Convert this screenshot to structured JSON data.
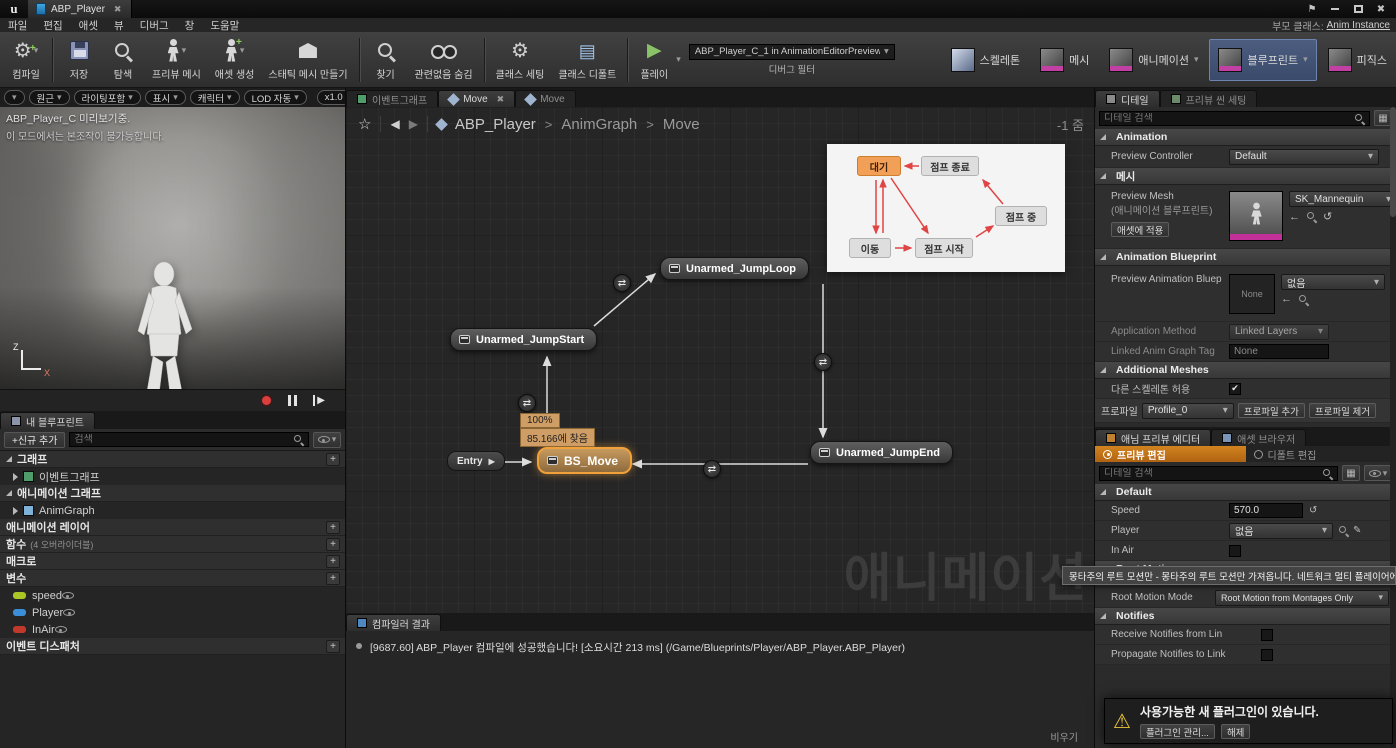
{
  "titlebar": {
    "logo": "u",
    "tab_title": "ABP_Player"
  },
  "menubar": {
    "items": [
      "파일",
      "편집",
      "애셋",
      "뷰",
      "디버그",
      "창",
      "도움말"
    ],
    "parent_class_label": "부모 클래스:",
    "parent_class_value": "Anim Instance"
  },
  "toolbar": {
    "compile": "컴파일",
    "save": "저장",
    "browse": "탐색",
    "preview_mesh": "프리뷰 메시",
    "create_asset": "애셋 생성",
    "make_static_mesh": "스태틱 메시 만들기",
    "find": "찾기",
    "hide_unrelated": "관련없음 숨김",
    "class_settings": "클래스 세팅",
    "class_defaults": "클래스 디폴트",
    "play": "플레이",
    "debug_object": "ABP_Player_C_1 in AnimationEditorPreviewActor",
    "debug_filter": "디버그 필터",
    "modes": [
      "스켈레톤",
      "메시",
      "애니메이션",
      "블루프린트",
      "피직스"
    ]
  },
  "viewport": {
    "buttons": [
      "원근",
      "라이팅포함",
      "표시",
      "캐릭터",
      "LOD 자동"
    ],
    "scale_button": "x1.0",
    "overlay_title": "ABP_Player_C 미리보기중.",
    "overlay_subtitle": "이 모드에서는 본조작이 불가능합니다.",
    "axis_z": "Z",
    "axis_x": "X"
  },
  "my_blueprint": {
    "tab": "내 블루프린트",
    "add_new": "+신규 추가",
    "search_placeholder": "검색",
    "graph_header": "그래프",
    "event_graph": "이벤트그래프",
    "anim_graph_header": "애니메이션 그래프",
    "anim_graph": "AnimGraph",
    "anim_layers_header": "애니메이션 레이어",
    "functions_header": "함수",
    "functions_note": "(4 오버라이더블)",
    "macros_header": "매크로",
    "variables_header": "변수",
    "variables": [
      "speed",
      "Player",
      "InAir"
    ],
    "dispatchers_header": "이벤트 디스패처"
  },
  "graph": {
    "tabs": [
      "이벤트그래프",
      "Move",
      "Move"
    ],
    "breadcrumb": [
      "ABP_Player",
      "AnimGraph",
      "Move"
    ],
    "crumb_sep": ">",
    "zoom_label": "-1 줌",
    "entry_node": "Entry",
    "nodes": {
      "bs_move": "BS_Move",
      "jump_start": "Unarmed_JumpStart",
      "jump_loop": "Unarmed_JumpLoop",
      "jump_end": "Unarmed_JumpEnd"
    },
    "tooltip_percent": "100%",
    "tooltip_position": "85.166에 찾음",
    "watermark": "애니메이션",
    "inset_states": {
      "idle": "대기",
      "jump_end": "점프 종료",
      "jump_mid": "점프 중",
      "move": "이동",
      "jump_start": "점프 시작"
    }
  },
  "compiler": {
    "tab": "컴파일러 결과",
    "log": "[9687.60] ABP_Player 컴파일에 성공했습니다! [소요시간 213 ms] (/Game/Blueprints/Player/ABP_Player.ABP_Player)",
    "clear_button": "비우기"
  },
  "details": {
    "tab_details": "디테일",
    "tab_preview_scene": "프리뷰 씬 세팅",
    "search_placeholder": "디테일 검색",
    "animation_header": "Animation",
    "preview_controller_label": "Preview Controller",
    "preview_controller_value": "Default",
    "mesh_header": "메시",
    "preview_mesh_label": "Preview Mesh",
    "preview_mesh_sublabel": "(애니메이션 블루프린트)",
    "apply_to_asset": "애셋에 적용",
    "preview_mesh_value": "SK_Mannequin",
    "anim_bp_header": "Animation Blueprint",
    "preview_anim_bp_label": "Preview Animation Bluep",
    "preview_anim_bp_value": "없음",
    "thumb_none": "None",
    "application_method_label": "Application Method",
    "application_method_value": "Linked Layers",
    "linked_tag_label": "Linked Anim Graph Tag",
    "linked_tag_value": "None",
    "additional_meshes_header": "Additional Meshes",
    "allow_other_skeleton_label": "다른 스켈레톤 허용",
    "profile_label": "프로파일",
    "profile_value": "Profile_0",
    "profile_add": "프로파일 추가",
    "profile_remove": "프로파일 제거"
  },
  "anim_preview": {
    "tab_editor": "애님 프리뷰 에디터",
    "tab_browser": "애셋 브라우저",
    "edit_preview": "프리뷰 편집",
    "edit_defaults": "디폴트 편집",
    "search_placeholder": "디테일 검색",
    "default_header": "Default",
    "speed_label": "Speed",
    "speed_value": "570.0",
    "player_label": "Player",
    "player_value": "없음",
    "in_air_label": "In Air",
    "root_motion_header": "Root Motion",
    "root_motion_mode_label": "Root Motion Mode",
    "root_motion_mode_value": "Root Motion from Montages Only",
    "tooltip": "몽타주의 루트 모션만 - 몽타주의 루트 모션만 가져옵니다. 네트워크 멀티 플레이어에 적합합니다",
    "notifies_header": "Notifies",
    "receive_notifies_label": "Receive Notifies from Lin",
    "propagate_notifies_label": "Propagate Notifies to Link"
  },
  "notification": {
    "message": "사용가능한 새 플러그인이 있습니다.",
    "manage_button": "플러그인 관리...",
    "dismiss_button": "해제"
  }
}
